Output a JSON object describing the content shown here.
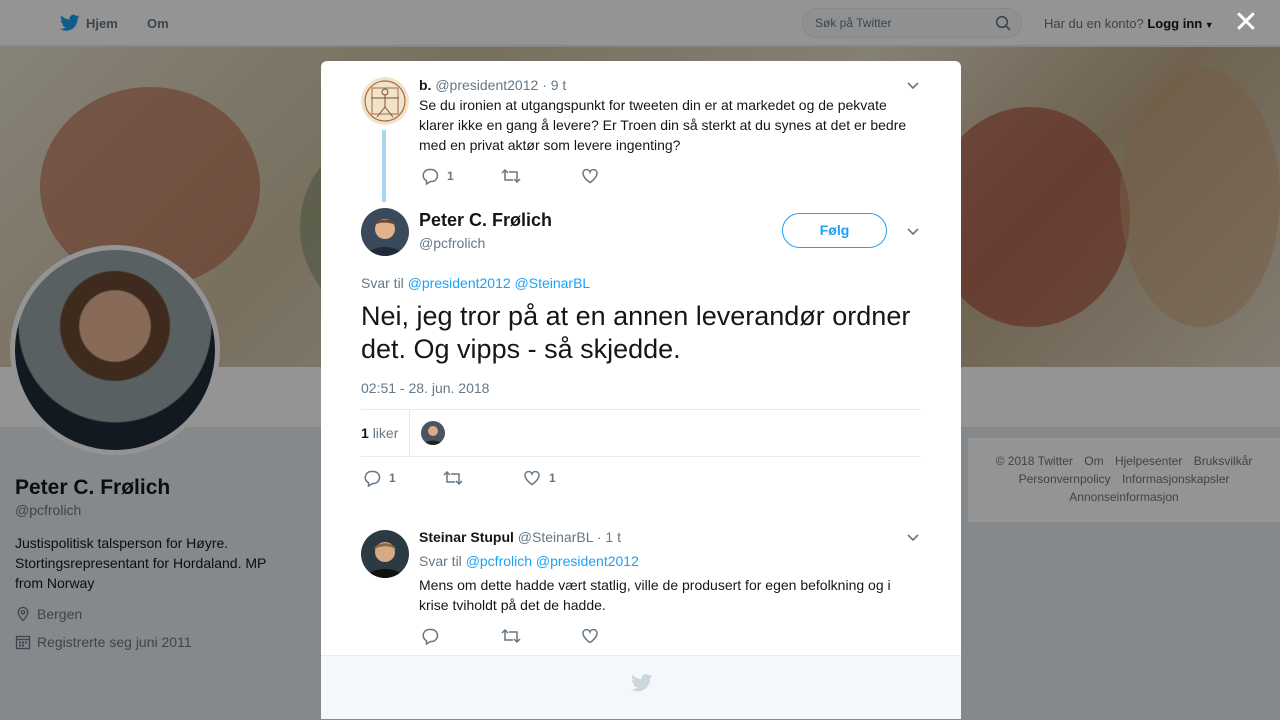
{
  "nav": {
    "home_label": "Hjem",
    "about_label": "Om",
    "search_placeholder": "Søk på Twitter",
    "account_prompt": "Har du en konto?",
    "login_label": "Logg inn"
  },
  "profile": {
    "name": "Peter C. Frølich",
    "handle": "@pcfrolich",
    "bio": "Justispolitisk talsperson for Høyre. Stortingsrepresentant for Hordaland. MP from Norway",
    "location": "Bergen",
    "joined": "Registrerte seg juni 2011"
  },
  "footer": {
    "links": [
      "© 2018 Twitter",
      "Om",
      "Hjelpesenter",
      "Bruksvilkår",
      "Personvernpolicy",
      "Informasjonskapsler",
      "Annonseinformasjon"
    ]
  },
  "parent_tweet": {
    "name": "b.",
    "handle": "@president2012",
    "time": "· 9 t",
    "text": "Se du ironien at utgangspunkt for tweeten din er at markedet og de pekvate klarer ikke en gang å levere? Er Troen din så sterkt at du synes at det er bedre med en privat aktør som levere ingenting?",
    "reply_count": "1"
  },
  "main_tweet": {
    "name": "Peter C. Frølich",
    "handle": "@pcfrolich",
    "follow_label": "Følg",
    "reply_prefix": "Svar til",
    "reply_mentions": "@president2012 @SteinarBL",
    "text": "Nei, jeg tror på at en annen leverandør ordner det. Og vipps - så skjedde.",
    "timestamp": "02:51 - 28. jun. 2018",
    "likes_count": "1",
    "likes_label": "liker",
    "reply_count": "1",
    "like_count": "1"
  },
  "reply_tweet": {
    "name": "Steinar Stupul",
    "handle": "@SteinarBL",
    "time": "· 1 t",
    "reply_prefix": "Svar til",
    "reply_mentions": "@pcfrolich @president2012",
    "text": "Mens om dette hadde vært statlig, ville de produsert for egen befolkning og i krise tviholdt på det de hadde."
  },
  "colors": {
    "accent": "#1da1f2",
    "text": "#14171a",
    "muted": "#657786"
  }
}
